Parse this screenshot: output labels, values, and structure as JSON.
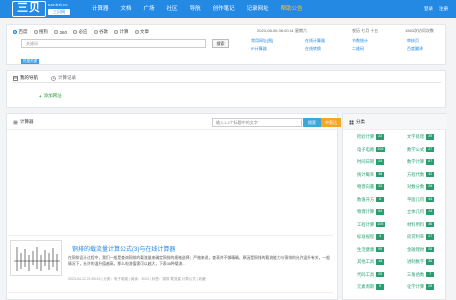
{
  "header": {
    "logo_cn": "三贝",
    "logo_pinyin": "sanbeicn",
    "logo_domain": "三贝网",
    "nav": [
      "计算器",
      "文档",
      "广场",
      "社区",
      "导航",
      "创作笔记",
      "记录网址",
      "帮助公告"
    ],
    "active_nav_index": 7,
    "login": "登录",
    "register": "注册"
  },
  "search": {
    "engines": [
      {
        "label": "百度",
        "selected": true
      },
      {
        "label": "搜狗",
        "selected": false
      },
      {
        "label": "360",
        "selected": false
      },
      {
        "label": "必应",
        "selected": false
      },
      {
        "label": "谷歌",
        "selected": false
      },
      {
        "label": "计算",
        "selected": false
      },
      {
        "label": "文章",
        "selected": false
      }
    ],
    "placeholder": "关键词",
    "button": "搜索",
    "tag": "热搜关键"
  },
  "info": {
    "date": "2023-08-06 06:00:11 星期六",
    "lunar": "农历 七月 十五",
    "online": "1563次访问次数",
    "quick_links": [
      [
        "常用网址[图]",
        "在线计算器",
        "节数统计",
        "审核页"
      ],
      [
        "IP计算器",
        "在线转换",
        "二维码",
        "百度翻译"
      ]
    ]
  },
  "tabs": {
    "items": [
      "我的导航",
      "计算记录"
    ],
    "add_url": "添加网址"
  },
  "calculator": {
    "title": "计算器",
    "search_placeholder": "输入1-2个标题中的文字",
    "search_button": "搜索",
    "mid_button": "中直达"
  },
  "article": {
    "title": "铜排的载流量计算公式(3)与在线计算器",
    "body": "在铜排设计过程中，我们一般是查询铜排的载流量来确定铜排的规格选择；严格来说，查表并不够精确，原因是铜排的载流能力与铜排的允许温升有关，一般情况下，允许的温升值越高，那么电流值需可以越大，下表38种载流...",
    "meta": "2023-04-12 21:50:19 | 分类：电子电路 | 阅读：3024 | 标签：铜排 载流量 计算公式 | 收藏"
  },
  "categories": {
    "title": "分类",
    "items": [
      {
        "label": "检验计算",
        "count": "22"
      },
      {
        "label": "文字处理",
        "count": "39"
      },
      {
        "label": "电子电路",
        "count": "108"
      },
      {
        "label": "数学公式",
        "count": "27"
      },
      {
        "label": "时间日期",
        "count": "24"
      },
      {
        "label": "数学计算",
        "count": "87"
      },
      {
        "label": "统计概率",
        "count": "38"
      },
      {
        "label": "方程代数",
        "count": "32"
      },
      {
        "label": "物理向量",
        "count": "33"
      },
      {
        "label": "对数分数",
        "count": "26"
      },
      {
        "label": "数值开方",
        "count": "6"
      },
      {
        "label": "平面几何",
        "count": "44"
      },
      {
        "label": "物理计算",
        "count": "54"
      },
      {
        "label": "立体几何",
        "count": "14"
      },
      {
        "label": "工程计算",
        "count": "105"
      },
      {
        "label": "材料用料",
        "count": "36"
      },
      {
        "label": "标准规程",
        "count": "4"
      },
      {
        "label": "房贷利率",
        "count": "17"
      },
      {
        "label": "生活健康",
        "count": "59"
      },
      {
        "label": "金融理财",
        "count": "26"
      },
      {
        "label": "其他工具",
        "count": "18"
      },
      {
        "label": "进制数字",
        "count": "36"
      },
      {
        "label": "代码工具",
        "count": "25"
      },
      {
        "label": "三角函数",
        "count": "7"
      },
      {
        "label": "元素周期",
        "count": "9"
      },
      {
        "label": "化学计算",
        "count": "25"
      }
    ]
  },
  "colors": {
    "header_bg": "#2389e3",
    "active_nav": "#ffc33d",
    "category_green": "#2a9d6f"
  }
}
